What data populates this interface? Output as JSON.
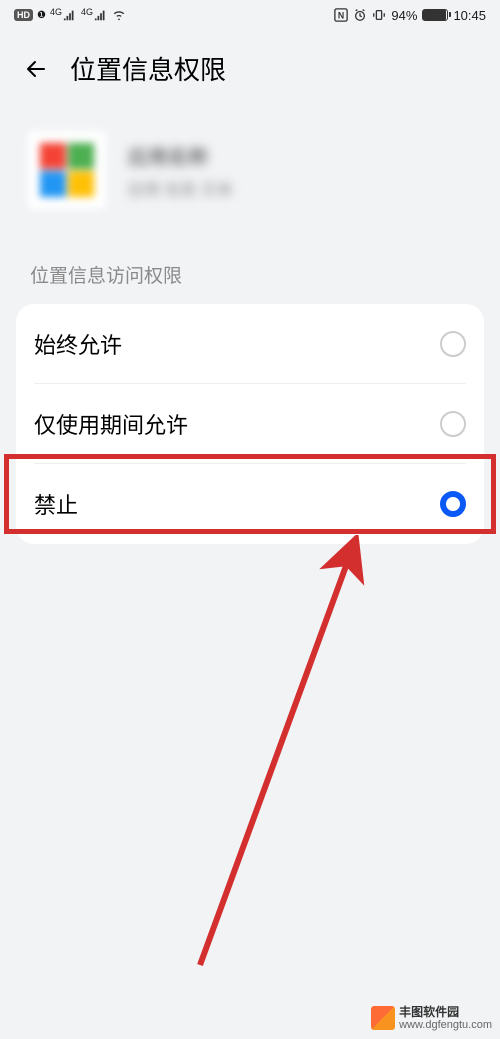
{
  "status_bar": {
    "hd_label": "HD",
    "signal1": "4G",
    "signal2": "4G",
    "nfc": "N",
    "battery_pct": "94%",
    "time": "10:45"
  },
  "header": {
    "title": "位置信息权限"
  },
  "app": {
    "name": "应用名称",
    "subtitle": "应用 信息 文本"
  },
  "section": {
    "label": "位置信息访问权限"
  },
  "options": [
    {
      "label": "始终允许",
      "selected": false
    },
    {
      "label": "仅使用期间允许",
      "selected": false
    },
    {
      "label": "禁止",
      "selected": true
    }
  ],
  "watermark": {
    "title": "丰图软件园",
    "url": "www.dgfengtu.com"
  }
}
